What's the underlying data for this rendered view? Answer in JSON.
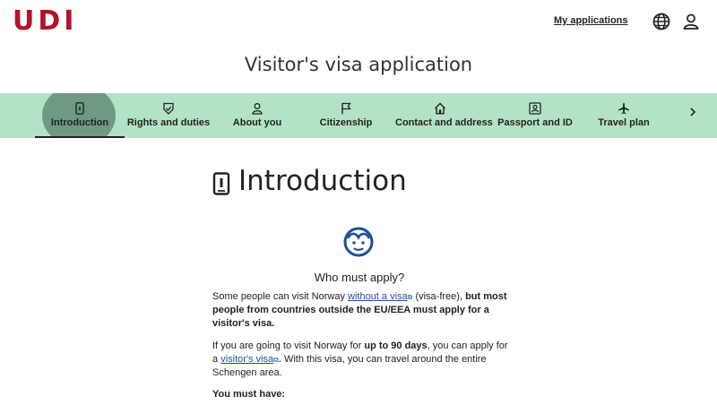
{
  "header": {
    "logo": "UDI",
    "my_applications": "My applications",
    "icons": [
      "globe-icon",
      "user-icon"
    ]
  },
  "page_title": "Visitor's visa application",
  "steps": [
    {
      "label": "Introduction",
      "icon": "phone-icon",
      "active": true
    },
    {
      "label": "Rights and duties",
      "icon": "shield-check-icon"
    },
    {
      "label": "About you",
      "icon": "person-icon"
    },
    {
      "label": "Citizenship",
      "icon": "flag-icon"
    },
    {
      "label": "Contact and address",
      "icon": "home-icon"
    },
    {
      "label": "Passport and ID",
      "icon": "id-card-icon"
    },
    {
      "label": "Travel plan",
      "icon": "airplane-icon"
    }
  ],
  "content": {
    "heading": "Introduction",
    "subheading": "Who must apply?",
    "p1": {
      "a": "Some people can visit Norway ",
      "link": "without a visa",
      "b": " (visa-free), ",
      "bold": "but most people from countries outside the EU/EEA must apply for a visitor's visa."
    },
    "p2": {
      "a": "If you are going to visit Norway for ",
      "bold": "up to 90 days",
      "b": ", you can apply for a ",
      "link": "visitor's visa",
      "c": ". With this visa, you can travel around the entire Schengen area."
    },
    "you_must_have": "You must have:"
  },
  "colors": {
    "brand_red": "#b3132b",
    "nav_bg": "#b3e3c6",
    "active_bubble": "#6e9a83",
    "link": "#1f4e9c"
  }
}
